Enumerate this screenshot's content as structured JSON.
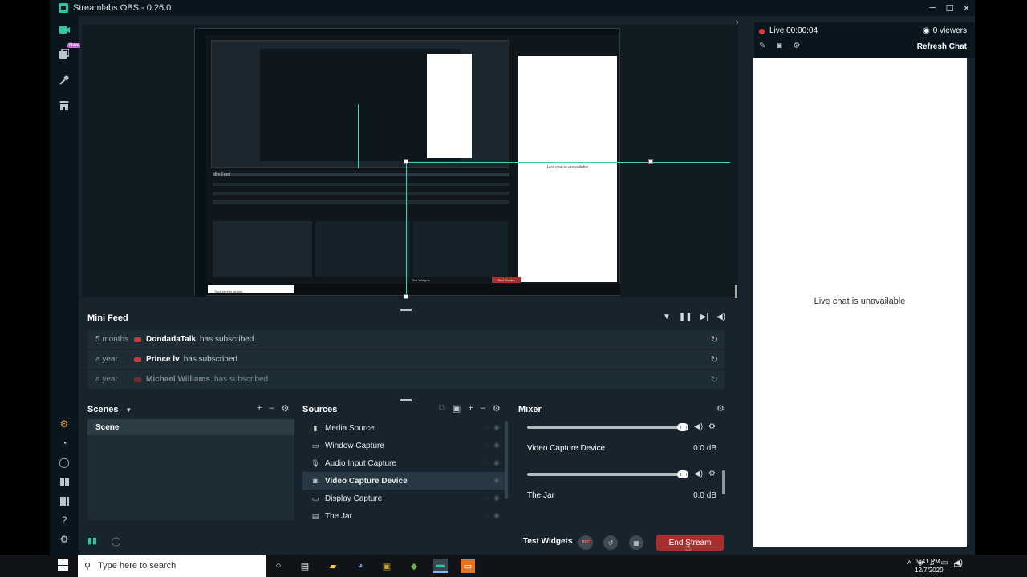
{
  "window": {
    "title": "Streamlabs OBS - 0.26.0",
    "minimize": "─",
    "maximize": "☐",
    "close": "✕"
  },
  "nav": {
    "new_badge": "New"
  },
  "preview": {
    "inner_chat_msg": "Live chat is unavailable",
    "inner_minifeed": "Mini Feed",
    "inner_search": "Type here to search",
    "inner_end_stream": "End Stream",
    "inner_test_widgets": "Test Widgets"
  },
  "minifeed": {
    "title": "Mini Feed",
    "items": [
      {
        "time": "5 months",
        "name": "DondadaTalk",
        "text": "has subscribed"
      },
      {
        "time": "a year",
        "name": "Prince lv",
        "text": "has subscribed"
      },
      {
        "time": "a year",
        "name": "Michael Williams",
        "text": "has subscribed"
      }
    ]
  },
  "scenes": {
    "title": "Scenes",
    "items": [
      "Scene"
    ]
  },
  "sources": {
    "title": "Sources",
    "items": [
      {
        "label": "Media Source",
        "icon": "film-icon"
      },
      {
        "label": "Window Capture",
        "icon": "window-icon"
      },
      {
        "label": "Audio Input Capture",
        "icon": "microphone-icon"
      },
      {
        "label": "Video Capture Device",
        "icon": "camera-icon"
      },
      {
        "label": "Display Capture",
        "icon": "monitor-icon"
      },
      {
        "label": "The Jar",
        "icon": "browser-icon"
      }
    ]
  },
  "mixer": {
    "title": "Mixer",
    "channels": [
      {
        "name": "Video Capture Device",
        "db": "0.0 dB",
        "level": 1.0
      },
      {
        "name": "The Jar",
        "db": "0.0 dB",
        "level": 1.0
      }
    ]
  },
  "footer": {
    "test_widgets": "Test Widgets",
    "rec": "REC",
    "end_stream": "End Stream"
  },
  "chat": {
    "live": "Live 00:00:04",
    "viewers": "0 viewers",
    "refresh": "Refresh Chat",
    "unavailable": "Live chat is unavailable"
  },
  "taskbar": {
    "search_placeholder": "Type here to search",
    "time": "9:41 PM",
    "date": "12/7/2020"
  },
  "colors": {
    "accent": "#31c3a2",
    "end_stream": "#a92d2d",
    "live": "#e53b3b",
    "panel_bg": "#17242d"
  }
}
